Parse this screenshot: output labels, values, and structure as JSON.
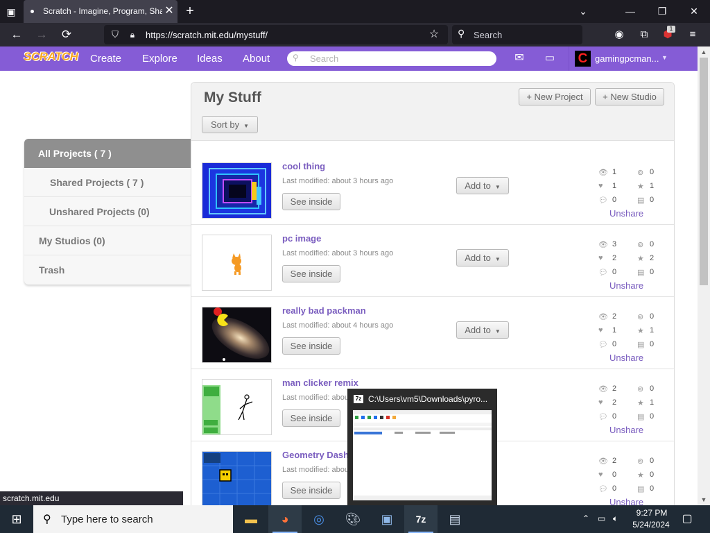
{
  "browser": {
    "tab_title": "Scratch - Imagine, Program, Share",
    "url": "https://scratch.mit.edu/mystuff/",
    "search_placeholder": "Search",
    "extension_badge": "1",
    "status_url": "scratch.mit.edu"
  },
  "scratch": {
    "logo": "SCRATCH",
    "nav": [
      "Create",
      "Explore",
      "Ideas",
      "About"
    ],
    "search_placeholder": "Search",
    "username": "gamingpcman...",
    "avatar_letter": "C",
    "brand_color": "#855cd6"
  },
  "mystuff": {
    "title": "My Stuff",
    "new_project": "+ New Project",
    "new_studio": "+ New Studio",
    "sort_by": "Sort by",
    "sidebar": [
      "All Projects ( 7 )",
      "Shared Projects ( 7 )",
      "Unshared Projects (0)",
      "My Studios (0)",
      "Trash"
    ],
    "projects": [
      {
        "title": "cool thing",
        "modified": "Last modified: about 3 hours ago",
        "views": "1",
        "loves": "1",
        "comments": "0",
        "remixes": "0",
        "favorites": "1",
        "studios": "0"
      },
      {
        "title": "pc image",
        "modified": "Last modified: about 3 hours ago",
        "views": "3",
        "loves": "2",
        "comments": "0",
        "remixes": "0",
        "favorites": "2",
        "studios": "0"
      },
      {
        "title": "really bad packman",
        "modified": "Last modified: about 4 hours ago",
        "views": "2",
        "loves": "1",
        "comments": "0",
        "remixes": "0",
        "favorites": "1",
        "studios": "0"
      },
      {
        "title": "man clicker remix",
        "modified": "Last modified: abou",
        "views": "2",
        "loves": "2",
        "comments": "0",
        "remixes": "0",
        "favorites": "1",
        "studios": "0"
      },
      {
        "title": "Geometry Dash",
        "modified": "Last modified: abou",
        "views": "2",
        "loves": "0",
        "comments": "0",
        "remixes": "0",
        "favorites": "0",
        "studios": "0"
      }
    ],
    "see_inside": "See inside",
    "add_to": "Add to",
    "unshare": "Unshare"
  },
  "taskbar": {
    "search_placeholder": "Type here to search",
    "time": "9:27 PM",
    "date": "5/24/2024",
    "preview_title": "C:\\Users\\vm5\\Downloads\\pyro...",
    "preview_app_label": "7z"
  }
}
